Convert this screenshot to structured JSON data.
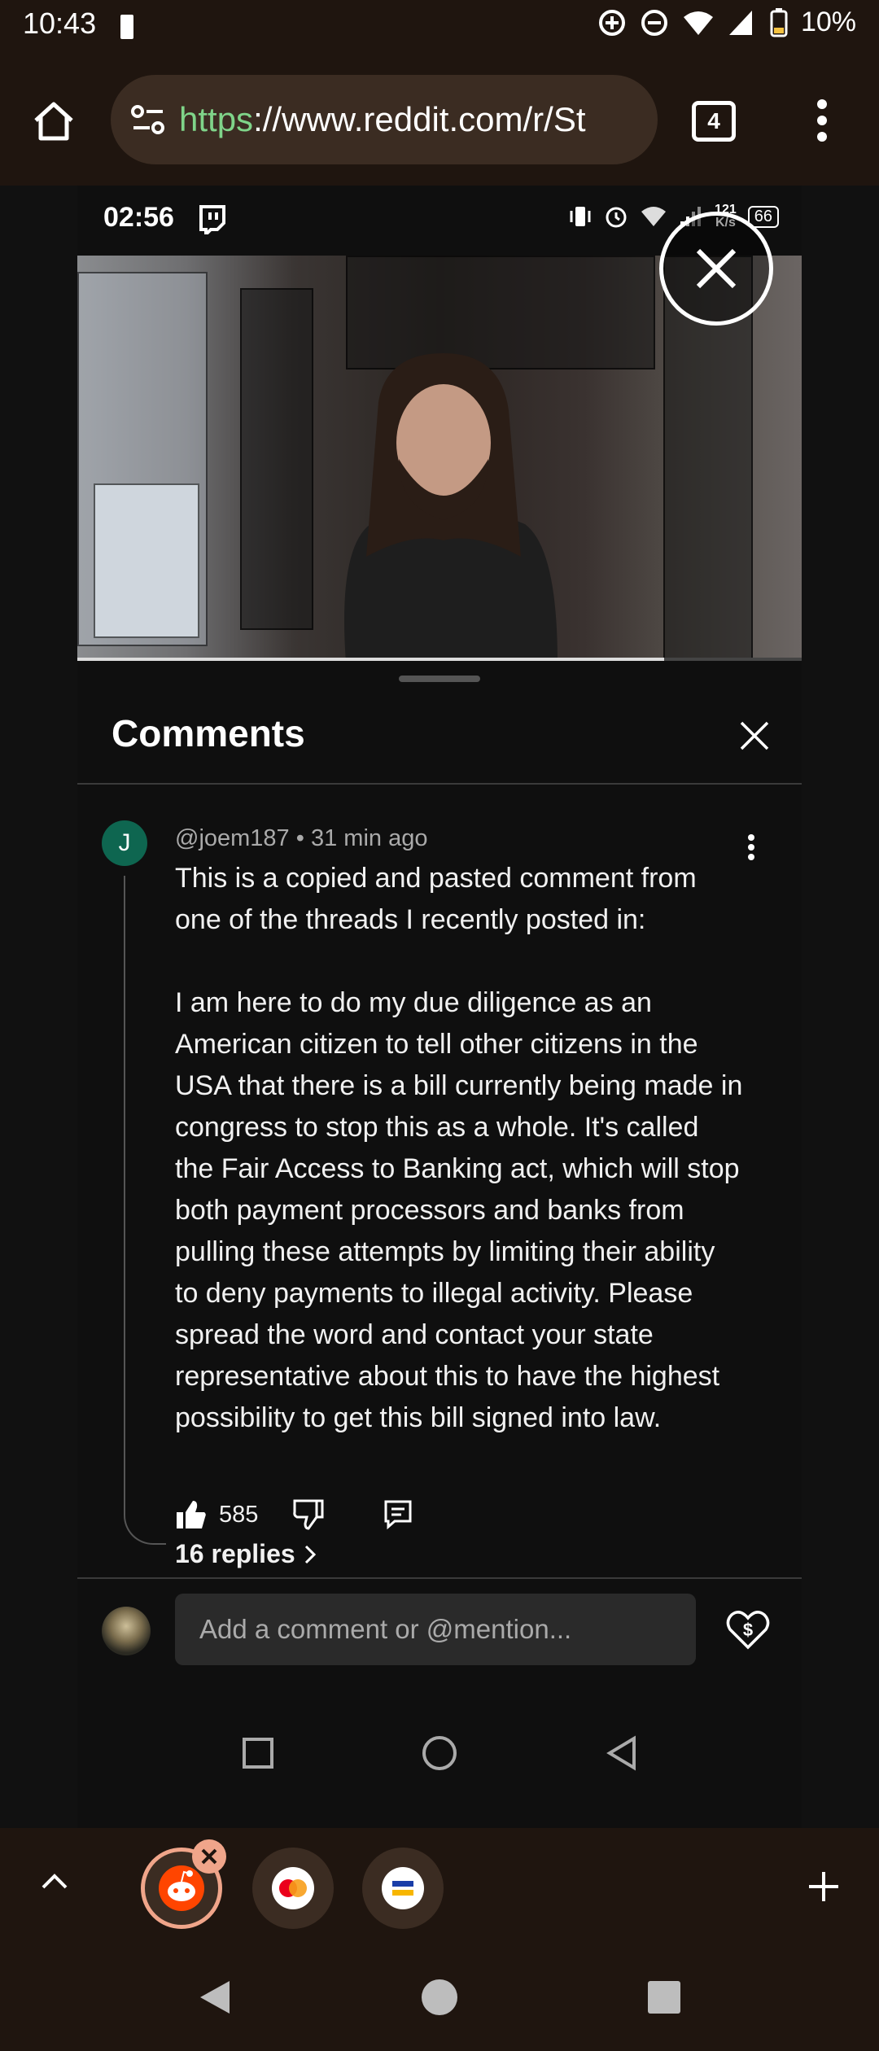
{
  "status_bar": {
    "time": "10:43",
    "battery": "10%"
  },
  "browser": {
    "url_scheme": "https",
    "url_rest": "://www.reddit.com/r/St",
    "tab_count": "4"
  },
  "embedded": {
    "time": "02:56",
    "speed_top": "121",
    "speed_unit": "K/s",
    "battery": "66",
    "video_progress": 0.81
  },
  "comments": {
    "title": "Comments",
    "avatar_initial": "J",
    "author": "@joem187",
    "separator": " • ",
    "time_ago": "31 min ago",
    "paragraph_1": "This is a copied and pasted comment from one of the threads I recently posted in:",
    "paragraph_2": "I am here to do my due diligence as an American citizen to tell other citizens in the USA that there is a bill currently being made in congress to stop this as a whole. It's called the Fair Access to Banking act, which will stop both payment processors and banks from pulling these attempts by limiting their ability to deny payments to illegal activity. Please spread the word and contact your state representative about this to have the highest possibility to get this bill signed into law.",
    "likes": "585",
    "replies_label": "16 replies",
    "input_placeholder": "Add a comment or @mention..."
  },
  "colors": {
    "browser_chrome": "#1f150f",
    "url_pill": "#3b2c22",
    "url_scheme": "#7fd489",
    "avatar_j": "#0e6650",
    "tab_accent": "#f0a58a",
    "reddit_orange": "#ff4500"
  },
  "icons": [
    "home-icon",
    "site-settings-icon",
    "more-vert-icon",
    "twitch-icon",
    "close-icon",
    "like-icon",
    "dislike-icon",
    "reply-icon",
    "chevron-right-icon",
    "super-thanks-icon",
    "square-icon",
    "circle-icon",
    "back-icon",
    "chevron-up-icon",
    "reddit-icon",
    "mastercard-icon",
    "plus-icon"
  ]
}
